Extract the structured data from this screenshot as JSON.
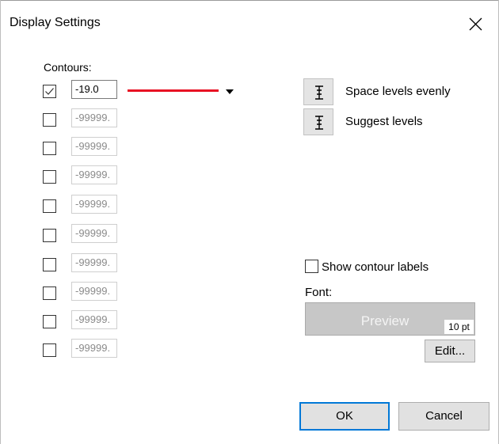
{
  "window": {
    "title": "Display Settings"
  },
  "contours": {
    "label": "Contours:",
    "rows": [
      {
        "checked": true,
        "value": "-19.0"
      },
      {
        "checked": false,
        "value": "-99999."
      },
      {
        "checked": false,
        "value": "-99999."
      },
      {
        "checked": false,
        "value": "-99999."
      },
      {
        "checked": false,
        "value": "-99999."
      },
      {
        "checked": false,
        "value": "-99999."
      },
      {
        "checked": false,
        "value": "-99999."
      },
      {
        "checked": false,
        "value": "-99999."
      },
      {
        "checked": false,
        "value": "-99999."
      },
      {
        "checked": false,
        "value": "-99999."
      }
    ],
    "line_color": "#e81123"
  },
  "actions": {
    "space_levels_evenly": "Space levels evenly",
    "suggest_levels": "Suggest levels",
    "icon": "level-spacing-icon"
  },
  "labels": {
    "show_contour_labels": "Show contour labels",
    "show_contour_labels_checked": false,
    "font_label": "Font:",
    "preview_text": "Preview",
    "font_size": "10 pt",
    "edit": "Edit..."
  },
  "buttons": {
    "ok": "OK",
    "cancel": "Cancel"
  },
  "colors": {
    "accent": "#0078d7",
    "button_bg": "#e1e1e1",
    "preview_bg": "#c7c7c7"
  }
}
